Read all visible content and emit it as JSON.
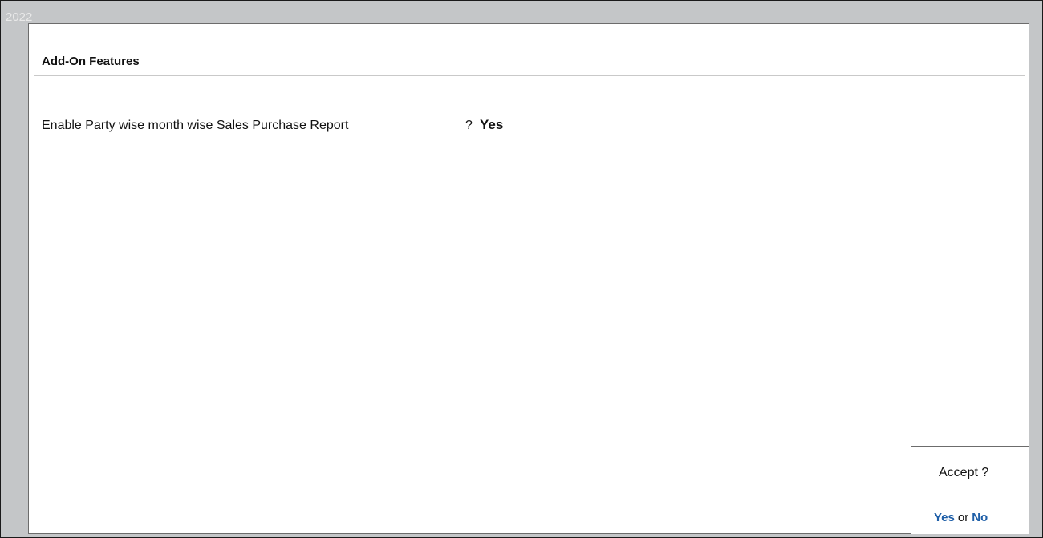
{
  "background": {
    "year_text": "2022"
  },
  "dialog": {
    "title": "Add-On Features",
    "field": {
      "label": "Enable Party wise month wise Sales Purchase Report",
      "separator": "?",
      "value": "Yes"
    }
  },
  "accept_prompt": {
    "question": "Accept ?",
    "yes_label": "Yes",
    "or_label": "or",
    "no_label": "No"
  },
  "colors": {
    "option_link": "#1f5fa8",
    "backdrop": "#c4c6c8"
  }
}
